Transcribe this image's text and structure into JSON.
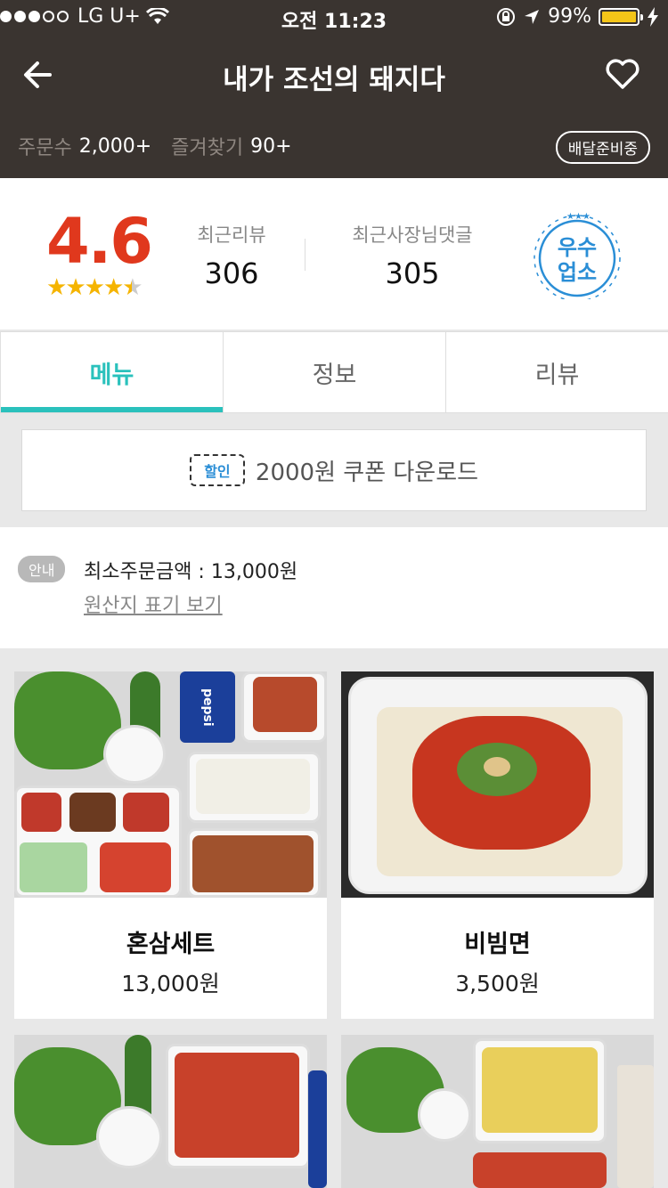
{
  "status_bar": {
    "carrier": "LG U+",
    "time": "오전 11:23",
    "battery": "99%",
    "signal_bars_filled": 3,
    "signal_bars_total": 5
  },
  "header": {
    "title": "내가 조선의 돼지다",
    "back_icon": "back-arrow-icon",
    "favorite_icon": "heart-icon"
  },
  "stats": {
    "orders_label": "주문수",
    "orders_value": "2,000+",
    "favorites_label": "즐겨찾기",
    "favorites_value": "90+",
    "delivery_status": "배달준비중"
  },
  "rating": {
    "score": "4.6",
    "stars": 4.5,
    "recent_reviews_label": "최근리뷰",
    "recent_reviews": "306",
    "owner_replies_label": "최근사장님댓글",
    "owner_replies": "305",
    "badge_line1": "우수",
    "badge_line2": "업소"
  },
  "tabs": [
    {
      "label": "메뉴",
      "active": true
    },
    {
      "label": "정보",
      "active": false
    },
    {
      "label": "리뷰",
      "active": false
    }
  ],
  "coupon": {
    "ticket_label": "할인",
    "text": "2000원 쿠폰 다운로드"
  },
  "info": {
    "tag": "안내",
    "min_order": "최소주문금액 : 13,000원",
    "origin_link": "원산지 표기 보기"
  },
  "menu": [
    {
      "name": "혼삼세트",
      "price": "13,000원"
    },
    {
      "name": "비빔면",
      "price": "3,500원"
    }
  ],
  "photo_text": {
    "can_label": "pepsi"
  },
  "colors": {
    "header_bg": "#3a3430",
    "accent": "#2ac1bc",
    "score": "#e0381d",
    "badge": "#2a8ed6"
  }
}
